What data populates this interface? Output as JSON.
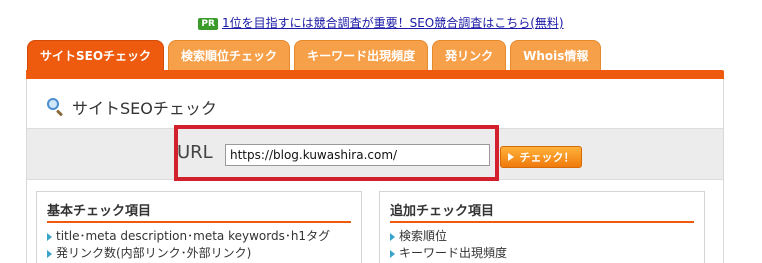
{
  "promo": {
    "badge": "PR",
    "text": "1位を目指すには競合調査が重要！SEO競合調査はこちら(無料)"
  },
  "tabs": [
    {
      "label": "サイトSEOチェック"
    },
    {
      "label": "検索順位チェック"
    },
    {
      "label": "キーワード出現頻度"
    },
    {
      "label": "発リンク"
    },
    {
      "label": "Whois情報"
    }
  ],
  "panel": {
    "title": "サイトSEOチェック"
  },
  "url_form": {
    "label": "URL",
    "value": "https://blog.kuwashira.com/",
    "button_label": "チェック！"
  },
  "basic_check": {
    "title": "基本チェック項目",
    "items": [
      "title･meta description･meta keywords･h1タグ",
      "発リンク数(内部リンク･外部リンク)"
    ]
  },
  "additional_check": {
    "title": "追加チェック項目",
    "items": [
      "検索順位",
      "キーワード出現頻度"
    ]
  },
  "colors": {
    "accent": "#ee5a0e",
    "tab_inactive": "#f6a04a",
    "highlight": "#d2202c"
  }
}
